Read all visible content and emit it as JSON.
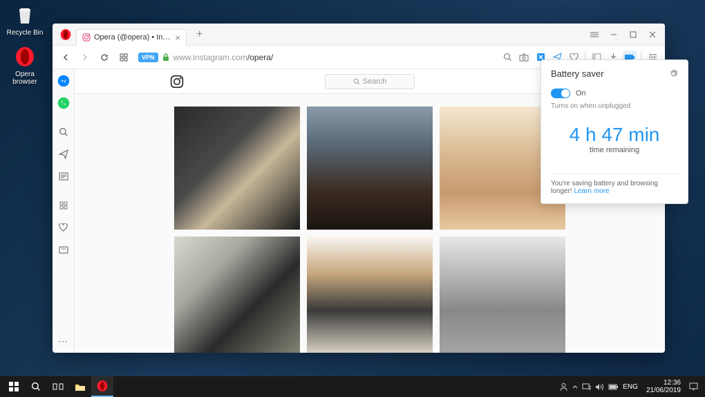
{
  "desktop": {
    "recycle_bin": "Recycle Bin",
    "opera_browser": "Opera browser"
  },
  "browser": {
    "tab": {
      "title": "Opera (@opera) • Instagram"
    },
    "url": {
      "domain": "www.instagram.com",
      "path": "/opera/"
    },
    "vpn": "VPN"
  },
  "page": {
    "search_placeholder": "Search"
  },
  "battery": {
    "title": "Battery saver",
    "toggle_label": "On",
    "hint": "Turns on when unplugged",
    "time_value": "4 h 47 min",
    "time_label": "time remaining",
    "footer_text": "You're saving battery and browsing longer! ",
    "learn_more": "Learn more"
  },
  "taskbar": {
    "lang": "ENG",
    "time": "12:36",
    "date": "21/06/2019"
  }
}
